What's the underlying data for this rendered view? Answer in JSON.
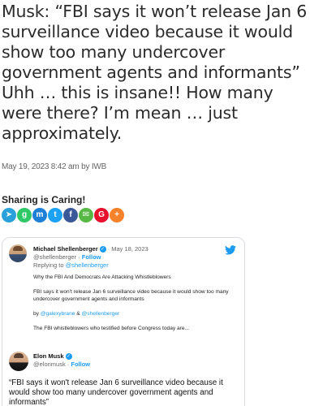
{
  "article": {
    "headline": "Musk: “FBI says it won’t release Jan 6 surveillance video because it would show too many undercover government agents and informants” Uhh … this is insane!! How many were there? I’m mean … just approximately.",
    "byline": "May 19, 2023 8:42 am by IWB"
  },
  "share": {
    "title": "Sharing is Caring!",
    "buttons": [
      {
        "name": "telegram",
        "glyph": "➤",
        "color": "#2aa1da"
      },
      {
        "name": "gab",
        "glyph": "g",
        "color": "#2ec866"
      },
      {
        "name": "mewe",
        "glyph": "m",
        "color": "#1e7fd6"
      },
      {
        "name": "twitter",
        "glyph": "t",
        "color": "#1da1f2"
      },
      {
        "name": "facebook",
        "glyph": "f",
        "color": "#3b5998"
      },
      {
        "name": "email",
        "glyph": "✉",
        "color": "#57b846"
      },
      {
        "name": "gettr",
        "glyph": "G",
        "color": "#e8112d"
      },
      {
        "name": "more",
        "glyph": "+",
        "color": "#f6812b"
      }
    ]
  },
  "tweet": {
    "quoted": {
      "author": "Michael Shellenberger",
      "date": "May 18, 2023",
      "handle": "@shellenberger",
      "follow": "Follow",
      "replying_prefix": "Replying to",
      "replying_to": "@shellenberger",
      "line1": "Why the FBI And Democrats Are Attacking Whistleblowers",
      "line2": "FBI says it won't release Jan 6 surveillance video because it would show too many undercover government agents and informants",
      "by_prefix": "by",
      "by_author1": "@galexybrane",
      "by_amp": "&",
      "by_author2": "@shellenberger",
      "line3": "The FBI whistleblowers who testified before Congress today are..."
    },
    "main": {
      "author": "Elon Musk",
      "handle": "@elonmusk",
      "follow": "Follow",
      "text": "“FBI says it won't release Jan 6 surveillance video because it would show too many undercover government agents and informants”"
    }
  }
}
